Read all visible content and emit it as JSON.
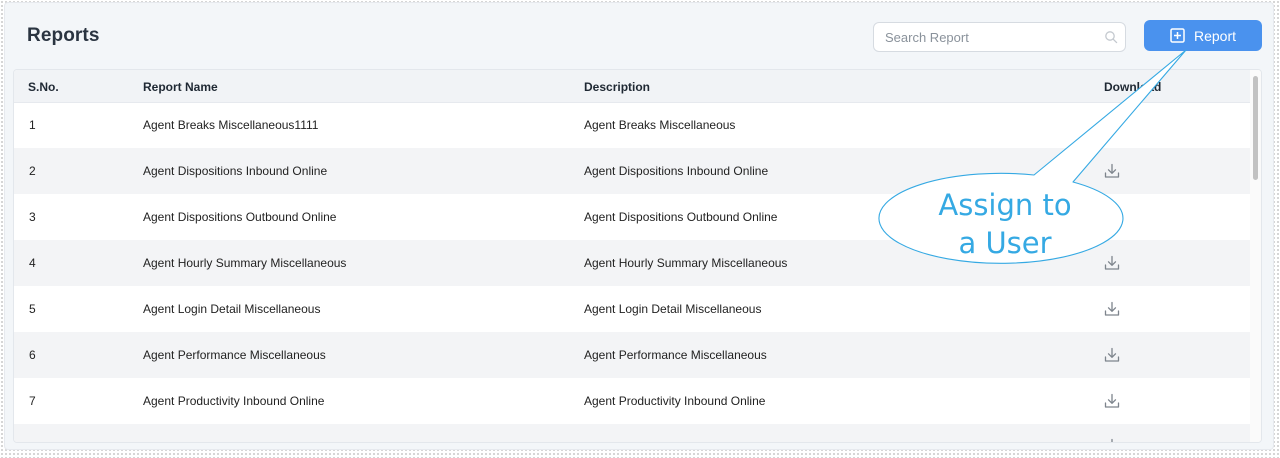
{
  "page": {
    "title": "Reports"
  },
  "search": {
    "placeholder": "Search Report"
  },
  "toolbar": {
    "add_report_label": "Report"
  },
  "table": {
    "headers": {
      "sno": "S.No.",
      "name": "Report Name",
      "description": "Description",
      "download": "Download"
    },
    "rows": [
      {
        "sno": "1",
        "name": "Agent Breaks Miscellaneous1111",
        "description": "Agent Breaks Miscellaneous"
      },
      {
        "sno": "2",
        "name": "Agent Dispositions Inbound Online",
        "description": "Agent Dispositions Inbound Online"
      },
      {
        "sno": "3",
        "name": "Agent Dispositions Outbound Online",
        "description": "Agent Dispositions Outbound Online"
      },
      {
        "sno": "4",
        "name": "Agent Hourly Summary Miscellaneous",
        "description": "Agent Hourly Summary Miscellaneous"
      },
      {
        "sno": "5",
        "name": "Agent Login Detail Miscellaneous",
        "description": "Agent Login Detail Miscellaneous"
      },
      {
        "sno": "6",
        "name": "Agent Performance Miscellaneous",
        "description": "Agent Performance Miscellaneous"
      },
      {
        "sno": "7",
        "name": "Agent Productivity Inbound Online",
        "description": "Agent Productivity Inbound Online"
      }
    ]
  },
  "annotation": {
    "line1": "Assign to",
    "line2": "a User"
  },
  "icons": {
    "search": "search-icon",
    "add": "plus-square-icon",
    "download": "download-icon"
  },
  "colors": {
    "accent": "#4a92ee",
    "callout": "#35a9e3",
    "row_alt": "#f3f4f6"
  }
}
